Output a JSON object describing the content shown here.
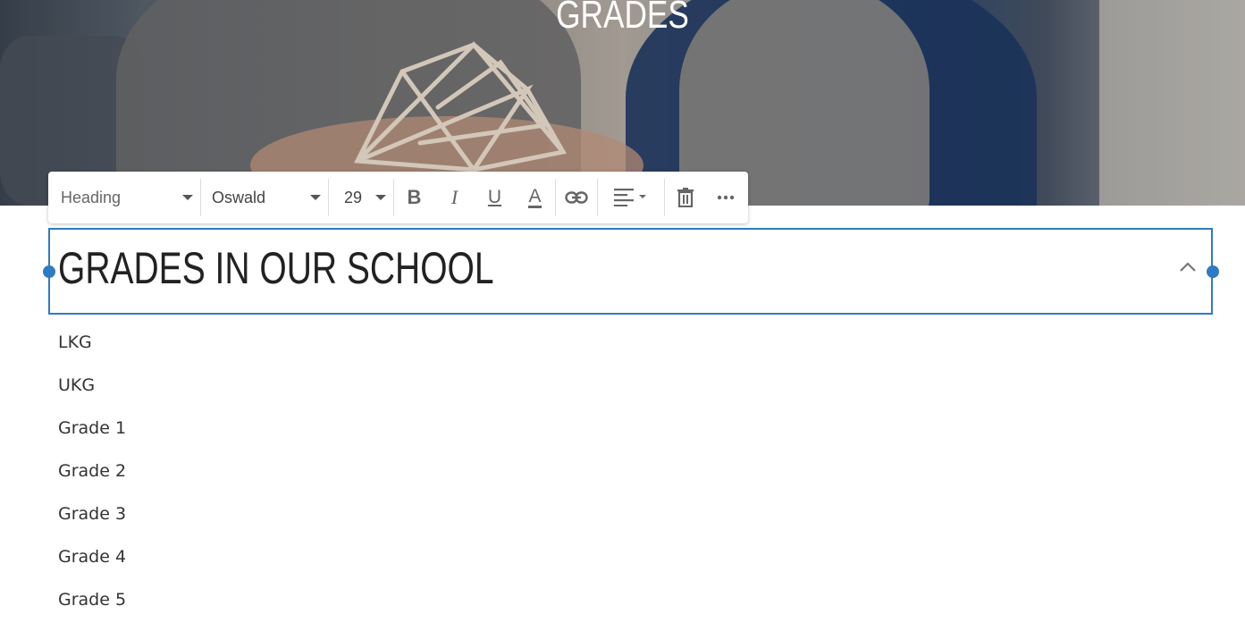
{
  "hero": {
    "title": "GRADES"
  },
  "toolbar": {
    "style_select": "Heading",
    "font_select": "Oswald",
    "size_select": "29",
    "buttons": {
      "bold": "B",
      "italic": "I",
      "underline": "U",
      "text_color": "A"
    },
    "icons": [
      "bold-icon",
      "italic-icon",
      "underline-icon",
      "text-color-icon",
      "link-icon",
      "align-left-icon",
      "delete-icon",
      "more-icon"
    ]
  },
  "heading": {
    "text": "GRADES IN OUR SCHOOL",
    "accent": "#2f7bc1"
  },
  "grades": [
    "LKG",
    "UKG",
    "Grade 1",
    "Grade 2",
    "Grade 3",
    "Grade 4",
    "Grade 5"
  ]
}
